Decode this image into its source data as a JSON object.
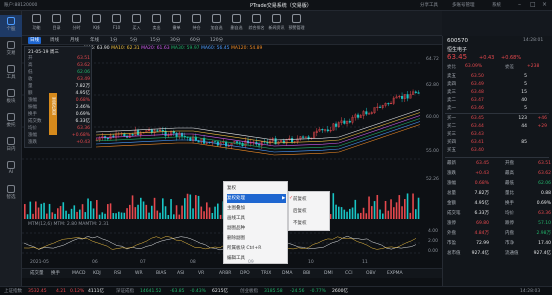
{
  "titlebar": {
    "app_account": "账户:88120000",
    "app_title": "PTrade交易系统（交易版）",
    "menu_items": [
      "分享工具",
      "多账号管理",
      "系统"
    ]
  },
  "leftnav": [
    {
      "label": "个股",
      "active": true
    },
    {
      "label": "交易"
    },
    {
      "label": "工具"
    },
    {
      "label": "板块"
    },
    {
      "label": "委托"
    },
    {
      "label": "日内"
    },
    {
      "label": "AI"
    },
    {
      "label": "智选"
    }
  ],
  "toolbar": [
    "功能",
    "目录",
    "分时",
    "K线",
    "F10",
    "买入",
    "卖出",
    "撤单",
    "持仓",
    "加自选",
    "删自选",
    "综合排名",
    "新闻资讯",
    "预警管理"
  ],
  "periods": [
    "日线",
    "周线",
    "月线",
    "年线",
    "1分",
    "5分",
    "15分",
    "30分",
    "60分",
    "120分"
  ],
  "active_period": "日线",
  "ma_line": {
    "label": "MA5: 63.90",
    "ma10": "MA10: 62.31",
    "ma20": "MA20: 61.63",
    "ma30": "MA30: 59.97",
    "ma60": "MA60: 56.45",
    "ma120": "MA120: 54.89"
  },
  "price_axis": [
    "64.72",
    "62.80",
    "60.00",
    "55.00",
    "52.26"
  ],
  "price_axis_sub": [
    "4.00",
    "2.00",
    "0.00"
  ],
  "infopanel": {
    "date": "21-05-19 周三",
    "rows": [
      {
        "label": "开",
        "value": "63.51",
        "cls": "r"
      },
      {
        "label": "高",
        "value": "63.62",
        "cls": "r"
      },
      {
        "label": "低",
        "value": "62.06",
        "cls": "g"
      },
      {
        "label": "收",
        "value": "63.49",
        "cls": "r"
      },
      {
        "label": "量",
        "value": "7.82万",
        "cls": "w"
      },
      {
        "label": "额",
        "value": "4.95亿",
        "cls": "w"
      },
      {
        "label": "涨幅",
        "value": "0.68%",
        "cls": "r"
      },
      {
        "label": "振幅",
        "value": "2.46%",
        "cls": "w"
      },
      {
        "label": "换手",
        "value": "0.69%",
        "cls": "w"
      },
      {
        "label": "成交数",
        "value": "6.33亿",
        "cls": "w"
      },
      {
        "label": "均价",
        "value": "63.36",
        "cls": "r"
      },
      {
        "label": "涨幅",
        "value": "+0.68%",
        "cls": "r"
      },
      {
        "label": "涨跌",
        "value": "+0.43",
        "cls": "r"
      }
    ],
    "side_tab": "显示信息"
  },
  "context_menu": {
    "items": [
      "复权处理",
      "主图叠加",
      "画线工具",
      "副图品种",
      "删除副图",
      "所属板块 Ctrl+R",
      "编辑工具"
    ],
    "hl": "复权处理",
    "sub": [
      "前复权",
      "后复权",
      "不复权"
    ],
    "checked": "前复权",
    "first": "复权"
  },
  "mtm_label": "MTM(12,6)  MTM: 2.80  MAMTM: 2.31",
  "x_axis": [
    "2021-05",
    "06",
    "07",
    "08",
    "09",
    "10",
    "11"
  ],
  "bottom_tabs": [
    "成交量",
    "换手",
    "MACD",
    "KDJ",
    "RSI",
    "WR",
    "BIAS",
    "ASI",
    "VR",
    "ARBR",
    "DPO",
    "TRIX",
    "DMA",
    "BBI",
    "DMI",
    "CCI",
    "OBV",
    "EXPMA"
  ],
  "stock": {
    "code": "600570",
    "name": "恒生电子",
    "price": "63.45",
    "change": "+0.43",
    "pct": "+0.68%",
    "time": "14:28:01"
  },
  "sell_orders": [
    {
      "label": "卖五",
      "px": "63.50",
      "vol": "5",
      "dlt": ""
    },
    {
      "label": "卖四",
      "px": "63.49",
      "vol": "5",
      "dlt": ""
    },
    {
      "label": "卖三",
      "px": "63.48",
      "vol": "15",
      "dlt": ""
    },
    {
      "label": "卖二",
      "px": "63.47",
      "vol": "40",
      "dlt": ""
    },
    {
      "label": "卖一",
      "px": "63.46",
      "vol": "5",
      "dlt": ""
    }
  ],
  "buy_orders": [
    {
      "label": "买一",
      "px": "63.45",
      "vol": "123",
      "dlt": "+46"
    },
    {
      "label": "买二",
      "px": "63.44",
      "vol": "44",
      "dlt": "+29"
    },
    {
      "label": "买三",
      "px": "63.43",
      "vol": "",
      "dlt": ""
    },
    {
      "label": "买四",
      "px": "63.41",
      "vol": "85",
      "dlt": ""
    },
    {
      "label": "买五",
      "px": "63.40",
      "vol": "",
      "dlt": ""
    }
  ],
  "webi": {
    "l": "委比",
    "v": "63.09%",
    "l2": "委差",
    "v2": "+238"
  },
  "stats": [
    {
      "l1": "最新",
      "v1": "63.45",
      "c1": "r",
      "l2": "开盘",
      "v2": "63.51",
      "c2": "r"
    },
    {
      "l1": "涨跌",
      "v1": "+0.43",
      "c1": "r",
      "l2": "最高",
      "v2": "63.62",
      "c2": "r"
    },
    {
      "l1": "涨幅",
      "v1": "0.68%",
      "c1": "r",
      "l2": "最低",
      "v2": "62.06",
      "c2": "g"
    },
    {
      "l1": "总量",
      "v1": "7.82万",
      "c1": "w",
      "l2": "量比",
      "v2": "0.88",
      "c2": "w"
    },
    {
      "l1": "金额",
      "v1": "4.95亿",
      "c1": "w",
      "l2": "换手",
      "v2": "0.69%",
      "c2": "w"
    },
    {
      "l1": "成交笔",
      "v1": "6.33万",
      "c1": "w",
      "l2": "均价",
      "v2": "63.36",
      "c2": "r"
    },
    {
      "l1": "涨停",
      "v1": "69.80",
      "c1": "r",
      "l2": "跌停",
      "v2": "57.10",
      "c2": "g"
    },
    {
      "l1": "外盘",
      "v1": "4.84万",
      "c1": "r",
      "l2": "内盘",
      "v2": "2.98万",
      "c2": "g"
    },
    {
      "l1": "市盈",
      "v1": "72.99",
      "c1": "w",
      "l2": "市净",
      "v2": "17.40",
      "c2": "w"
    },
    {
      "l1": "总市值",
      "v1": "927.4亿",
      "c1": "w",
      "l2": "流通值",
      "v2": "927.4亿",
      "c2": "w"
    }
  ],
  "status": {
    "sh_label": "上证指数",
    "sh_value": "3532.45",
    "sh_chg": "4.21",
    "sh_pct": "0.12%",
    "sh_amt": "4111亿",
    "sz_label": "深证成指",
    "sz_value": "14641.52",
    "sz_chg": "-63.85",
    "sz_pct": "-0.43%",
    "sz_amt": "6215亿",
    "cy_label": "创业板指",
    "cy_value": "3185.58",
    "cy_chg": "-24.56",
    "cy_pct": "-0.77%",
    "cy_amt": "2600亿",
    "time": "14:28:03"
  },
  "colors": {
    "accent": "#1e66d0",
    "up": "#e5484d",
    "down": "#21b36a",
    "bg": "#0d1014"
  }
}
